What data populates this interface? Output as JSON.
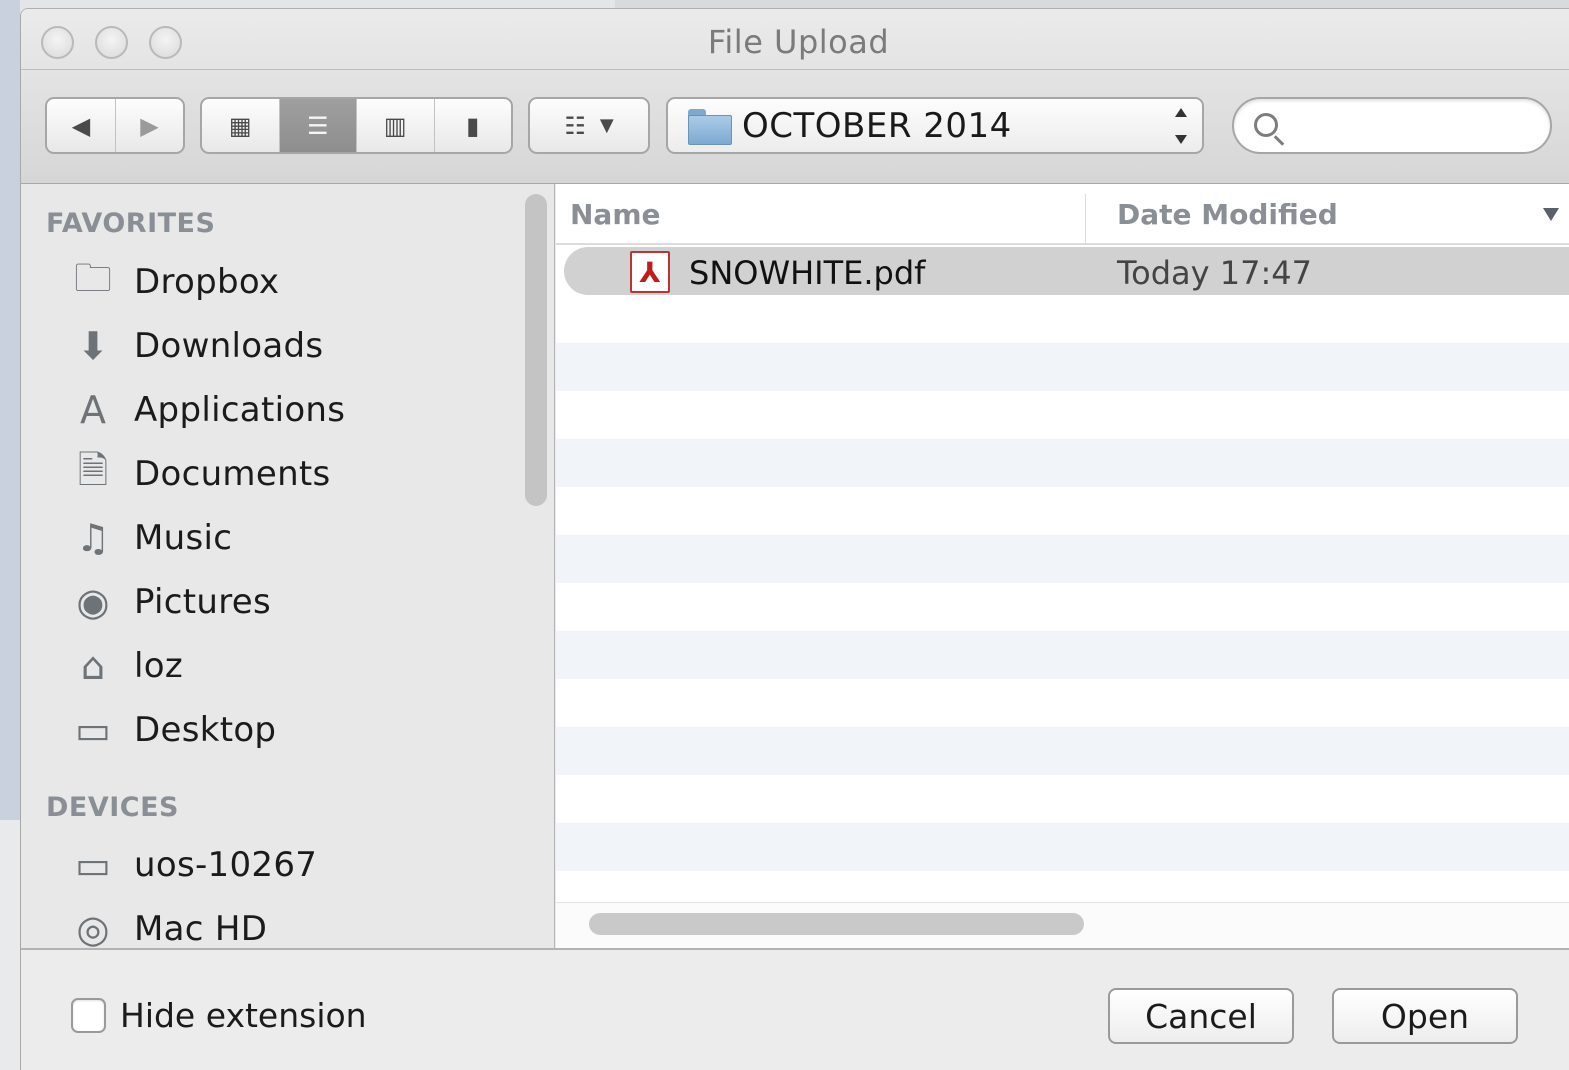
{
  "window": {
    "title": "File Upload"
  },
  "toolbar": {
    "back_icon": "◀",
    "forward_icon": "▶",
    "views": [
      {
        "name": "icon-view-icon",
        "glyph": "▦"
      },
      {
        "name": "list-view-icon",
        "glyph": "☰"
      },
      {
        "name": "column-view-icon",
        "glyph": "▥"
      },
      {
        "name": "coverflow-view-icon",
        "glyph": "▮"
      }
    ],
    "arrange_icon": "☷",
    "arrange_caret": "▼",
    "path_label": "OCTOBER 2014",
    "search_placeholder": ""
  },
  "sidebar": {
    "favorites_header": "FAVORITES",
    "favorites": [
      {
        "label": "Dropbox",
        "icon": "🗀"
      },
      {
        "label": "Downloads",
        "icon": "⬇"
      },
      {
        "label": "Applications",
        "icon": "A"
      },
      {
        "label": "Documents",
        "icon": "🗎"
      },
      {
        "label": "Music",
        "icon": "♫"
      },
      {
        "label": "Pictures",
        "icon": "◉"
      },
      {
        "label": "loz",
        "icon": "⌂"
      },
      {
        "label": "Desktop",
        "icon": "▭"
      }
    ],
    "devices_header": "DEVICES",
    "devices": [
      {
        "label": "uos-10267",
        "icon": "▭"
      },
      {
        "label": "Mac HD",
        "icon": "◎"
      }
    ]
  },
  "filelist": {
    "columns": {
      "name": "Name",
      "date": "Date Modified"
    },
    "files": [
      {
        "name": "SNOWHITE.pdf",
        "date": "Today 17:47",
        "icon": "⅄"
      }
    ]
  },
  "footer": {
    "hide_extension_label": "Hide extension",
    "cancel_label": "Cancel",
    "open_label": "Open"
  }
}
